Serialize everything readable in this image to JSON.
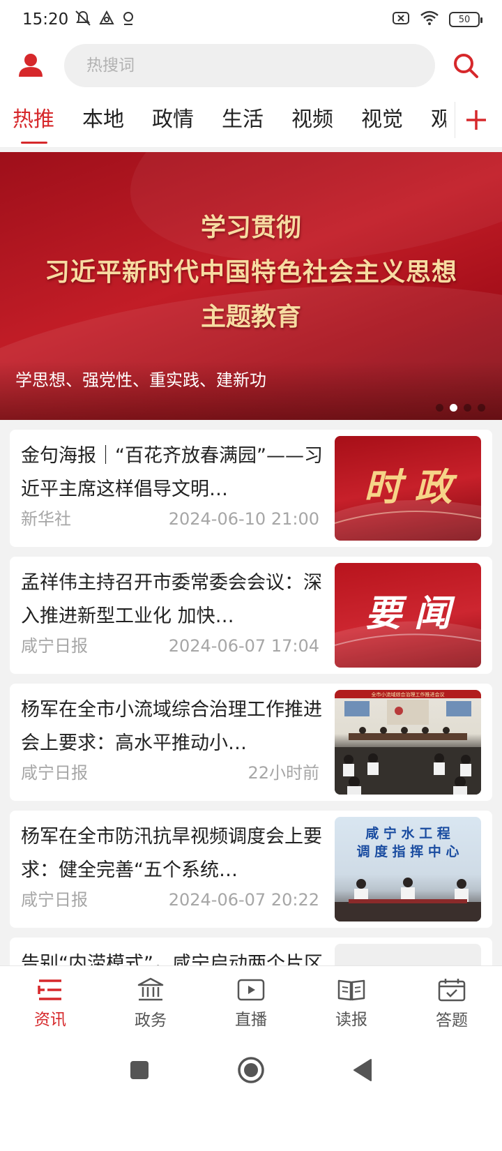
{
  "status_bar": {
    "time": "15:20",
    "battery": "50",
    "icons": [
      "mute-icon",
      "autopilot-icon",
      "location-icon",
      "no-sim-icon",
      "wifi-icon",
      "battery-icon"
    ]
  },
  "search": {
    "placeholder": "热搜词"
  },
  "tabs": [
    {
      "label": "热推",
      "active": true
    },
    {
      "label": "本地"
    },
    {
      "label": "政情"
    },
    {
      "label": "生活"
    },
    {
      "label": "视频"
    },
    {
      "label": "视觉"
    },
    {
      "label": "观"
    }
  ],
  "banner": {
    "line1": "学习贯彻",
    "line2": "习近平新时代中国特色社会主义思想",
    "line3": "主题教育",
    "caption": "学思想、强党性、重实践、建新功",
    "dots": 4,
    "active_dot": 2
  },
  "thumb_labels": {
    "shizheng": "时 政",
    "yaowen": "要 闻",
    "meeting_banner": "全市小流域综合治理工作推进会议",
    "water_line1": "咸 宁 水 工 程",
    "water_line2": "调 度 指 挥 中 心"
  },
  "news": [
    {
      "title": "金句海报｜“百花齐放春满园”——习近平主席这样倡导文明…",
      "source": "新华社",
      "time": "2024-06-10 21:00",
      "thumb": "shizheng"
    },
    {
      "title": "孟祥伟主持召开市委常委会会议：深入推进新型工业化 加快…",
      "source": "咸宁日报",
      "time": "2024-06-07 17:04",
      "thumb": "yaowen"
    },
    {
      "title": "杨军在全市小流域综合治理工作推进会上要求：高水平推动小…",
      "source": "咸宁日报",
      "time": "22小时前",
      "thumb": "meeting"
    },
    {
      "title": "杨军在全市防汛抗旱视频调度会上要求：健全完善“五个系统…",
      "source": "咸宁日报",
      "time": "2024-06-07 20:22",
      "thumb": "water"
    },
    {
      "title": "告别“内涝模式”，咸宁启动两个片区排水防涝建设！",
      "source": "",
      "time": "",
      "thumb": "loading"
    }
  ],
  "bottom_nav": [
    {
      "label": "资讯",
      "icon": "news-icon",
      "active": true
    },
    {
      "label": "政务",
      "icon": "government-icon"
    },
    {
      "label": "直播",
      "icon": "live-play-icon"
    },
    {
      "label": "读报",
      "icon": "newspaper-book-icon"
    },
    {
      "label": "答题",
      "icon": "quiz-calendar-icon"
    }
  ],
  "colors": {
    "accent": "#d6282b",
    "banner_gold": "#f7dca2"
  }
}
